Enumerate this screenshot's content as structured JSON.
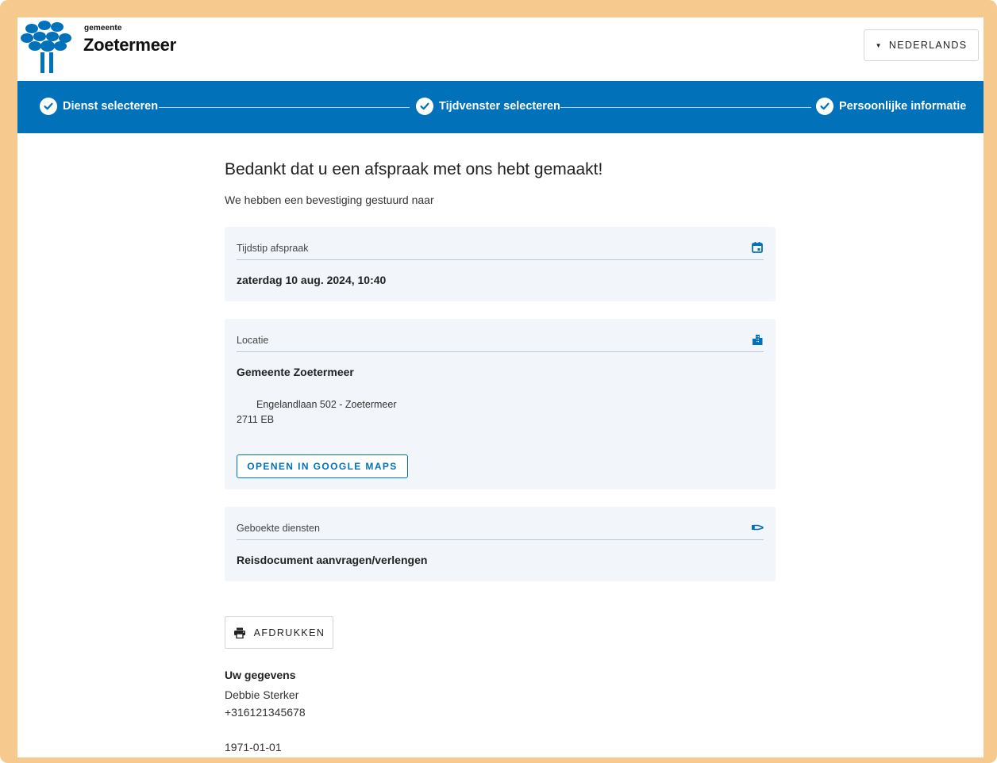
{
  "header": {
    "logo_small": "gemeente",
    "logo_name": "Zoetermeer",
    "language_label": "NEDERLANDS"
  },
  "stepper": {
    "steps": [
      {
        "label": "Dienst selecteren"
      },
      {
        "label": "Tijdvenster selecteren"
      },
      {
        "label": "Persoonlijke informatie"
      }
    ]
  },
  "main": {
    "title": "Bedankt dat u een afspraak met ons hebt gemaakt!",
    "subtitle": "We hebben een bevestiging gestuurd naar",
    "appointment": {
      "label": "Tijdstip afspraak",
      "value": "zaterdag 10 aug. 2024, 10:40",
      "icon": "calendar-icon"
    },
    "location": {
      "label": "Locatie",
      "name": "Gemeente Zoetermeer",
      "address_line1": "Engelandlaan 502 - Zoetermeer",
      "address_line2": "2711 EB",
      "maps_button": "OPENEN IN GOOGLE MAPS",
      "icon": "building-icon"
    },
    "services": {
      "label": "Geboekte diensten",
      "value": "Reisdocument aanvragen/verlengen",
      "icon": "hand-icon"
    },
    "print_button": "AFDRUKKEN",
    "personal": {
      "title": "Uw gegevens",
      "name": "Debbie Sterker",
      "phone": "+316121345678",
      "birthdate": "1971-01-01"
    }
  },
  "colors": {
    "brand_blue": "#0171b9",
    "card_bg": "#f2f6fa",
    "frame": "#f6c98f"
  }
}
